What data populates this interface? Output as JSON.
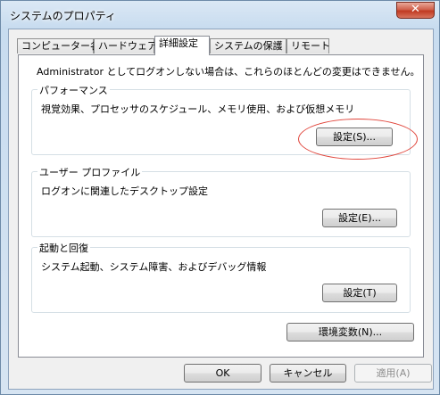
{
  "window": {
    "title": "システムのプロパティ",
    "close_glyph": "✕"
  },
  "tabs": [
    {
      "label": "コンピューター名"
    },
    {
      "label": "ハードウェア"
    },
    {
      "label": "詳細設定"
    },
    {
      "label": "システムの保護"
    },
    {
      "label": "リモート"
    }
  ],
  "active_tab": "詳細設定",
  "advanced": {
    "notice": "Administrator としてログオンしない場合は、これらのほとんどの変更はできません。",
    "performance": {
      "title": "パフォーマンス",
      "description": "視覚効果、プロセッサのスケジュール、メモリ使用、および仮想メモリ",
      "button": "設定(S)..."
    },
    "user_profile": {
      "title": "ユーザー プロファイル",
      "description": "ログオンに関連したデスクトップ設定",
      "button": "設定(E)..."
    },
    "startup_recovery": {
      "title": "起動と回復",
      "description": "システム起動、システム障害、およびデバッグ情報",
      "button": "設定(T)"
    },
    "env_button": "環境変数(N)..."
  },
  "footer": {
    "ok": "OK",
    "cancel": "キャンセル",
    "apply": "適用(A)"
  },
  "colors": {
    "highlight_ellipse": "#e0443a",
    "close_button": "#c03a22"
  }
}
